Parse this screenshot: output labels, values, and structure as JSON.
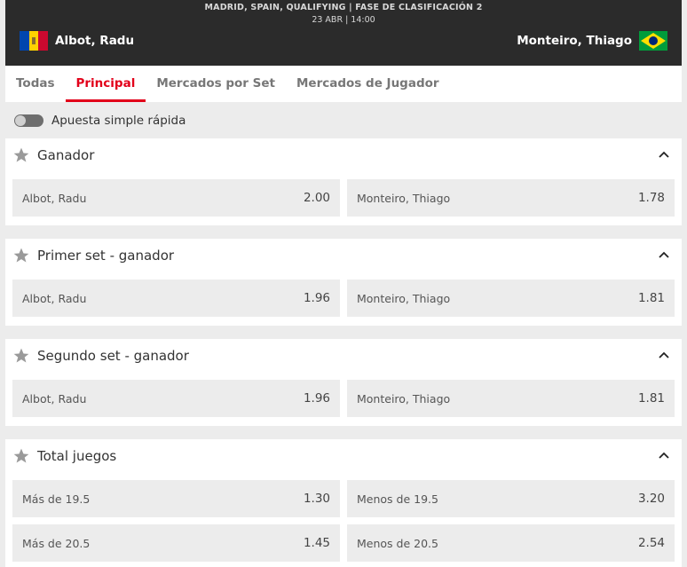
{
  "header": {
    "competition": "MADRID, SPAIN, QUALIFYING  |  FASE DE CLASIFICACIÓN  2",
    "date": "23 ABR | 14:00",
    "home_team": "Albot, Radu",
    "away_team": "Monteiro, Thiago",
    "home_flag": "moldova-flag-icon",
    "away_flag": "brazil-flag-icon"
  },
  "tabs": [
    {
      "label": "Todas",
      "active": false
    },
    {
      "label": "Principal",
      "active": true
    },
    {
      "label": "Mercados por Set",
      "active": false
    },
    {
      "label": "Mercados de Jugador",
      "active": false
    }
  ],
  "quick_bet": {
    "label": "Apuesta simple rápida",
    "enabled": false
  },
  "markets": [
    {
      "title": "Ganador",
      "rows": [
        [
          {
            "label": "Albot, Radu",
            "odds": "2.00"
          },
          {
            "label": "Monteiro, Thiago",
            "odds": "1.78"
          }
        ]
      ]
    },
    {
      "title": "Primer set - ganador",
      "rows": [
        [
          {
            "label": "Albot, Radu",
            "odds": "1.96"
          },
          {
            "label": "Monteiro, Thiago",
            "odds": "1.81"
          }
        ]
      ]
    },
    {
      "title": "Segundo set - ganador",
      "rows": [
        [
          {
            "label": "Albot, Radu",
            "odds": "1.96"
          },
          {
            "label": "Monteiro, Thiago",
            "odds": "1.81"
          }
        ]
      ]
    },
    {
      "title": "Total juegos",
      "rows": [
        [
          {
            "label": "Más de 19.5",
            "odds": "1.30"
          },
          {
            "label": "Menos de 19.5",
            "odds": "3.20"
          }
        ],
        [
          {
            "label": "Más de 20.5",
            "odds": "1.45"
          },
          {
            "label": "Menos de 20.5",
            "odds": "2.54"
          }
        ]
      ]
    }
  ],
  "colors": {
    "accent": "#e2001a",
    "header_bg": "#2b2b2b",
    "page_bg": "#ececec"
  }
}
